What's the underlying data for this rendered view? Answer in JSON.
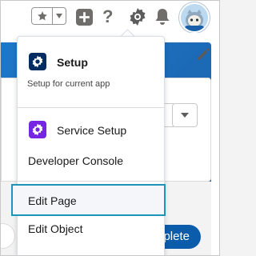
{
  "header": {
    "icons": [
      "star-icon",
      "chevron-down-icon",
      "plus-icon",
      "help-icon",
      "gear-icon",
      "bell-icon",
      "avatar"
    ],
    "help_glyph": "?"
  },
  "menu": {
    "setup": {
      "title": "Setup",
      "subtitle": "Setup for current app",
      "icon_color": "#032d60"
    },
    "items": [
      {
        "label": "Service Setup",
        "icon": "gear-icon",
        "icon_color": "#7526e3"
      },
      {
        "label": "Developer Console"
      },
      {
        "label": "Edit Page",
        "highlighted": true
      },
      {
        "label": "Edit Object"
      }
    ]
  },
  "background": {
    "complete_button_label": "mplete"
  },
  "colors": {
    "highlight_border": "#1b96b8",
    "brand_blue": "#0b5cab"
  }
}
